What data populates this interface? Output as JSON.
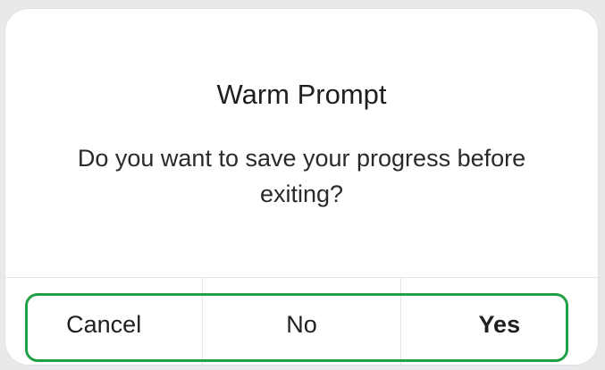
{
  "dialog": {
    "title": "Warm Prompt",
    "message": "Do you want to save your progress before exiting?",
    "buttons": {
      "cancel": "Cancel",
      "no": "No",
      "yes": "Yes"
    }
  },
  "colors": {
    "highlight": "#22a046",
    "dialog_background": "#ffffff",
    "page_background": "#e9e9ec"
  }
}
